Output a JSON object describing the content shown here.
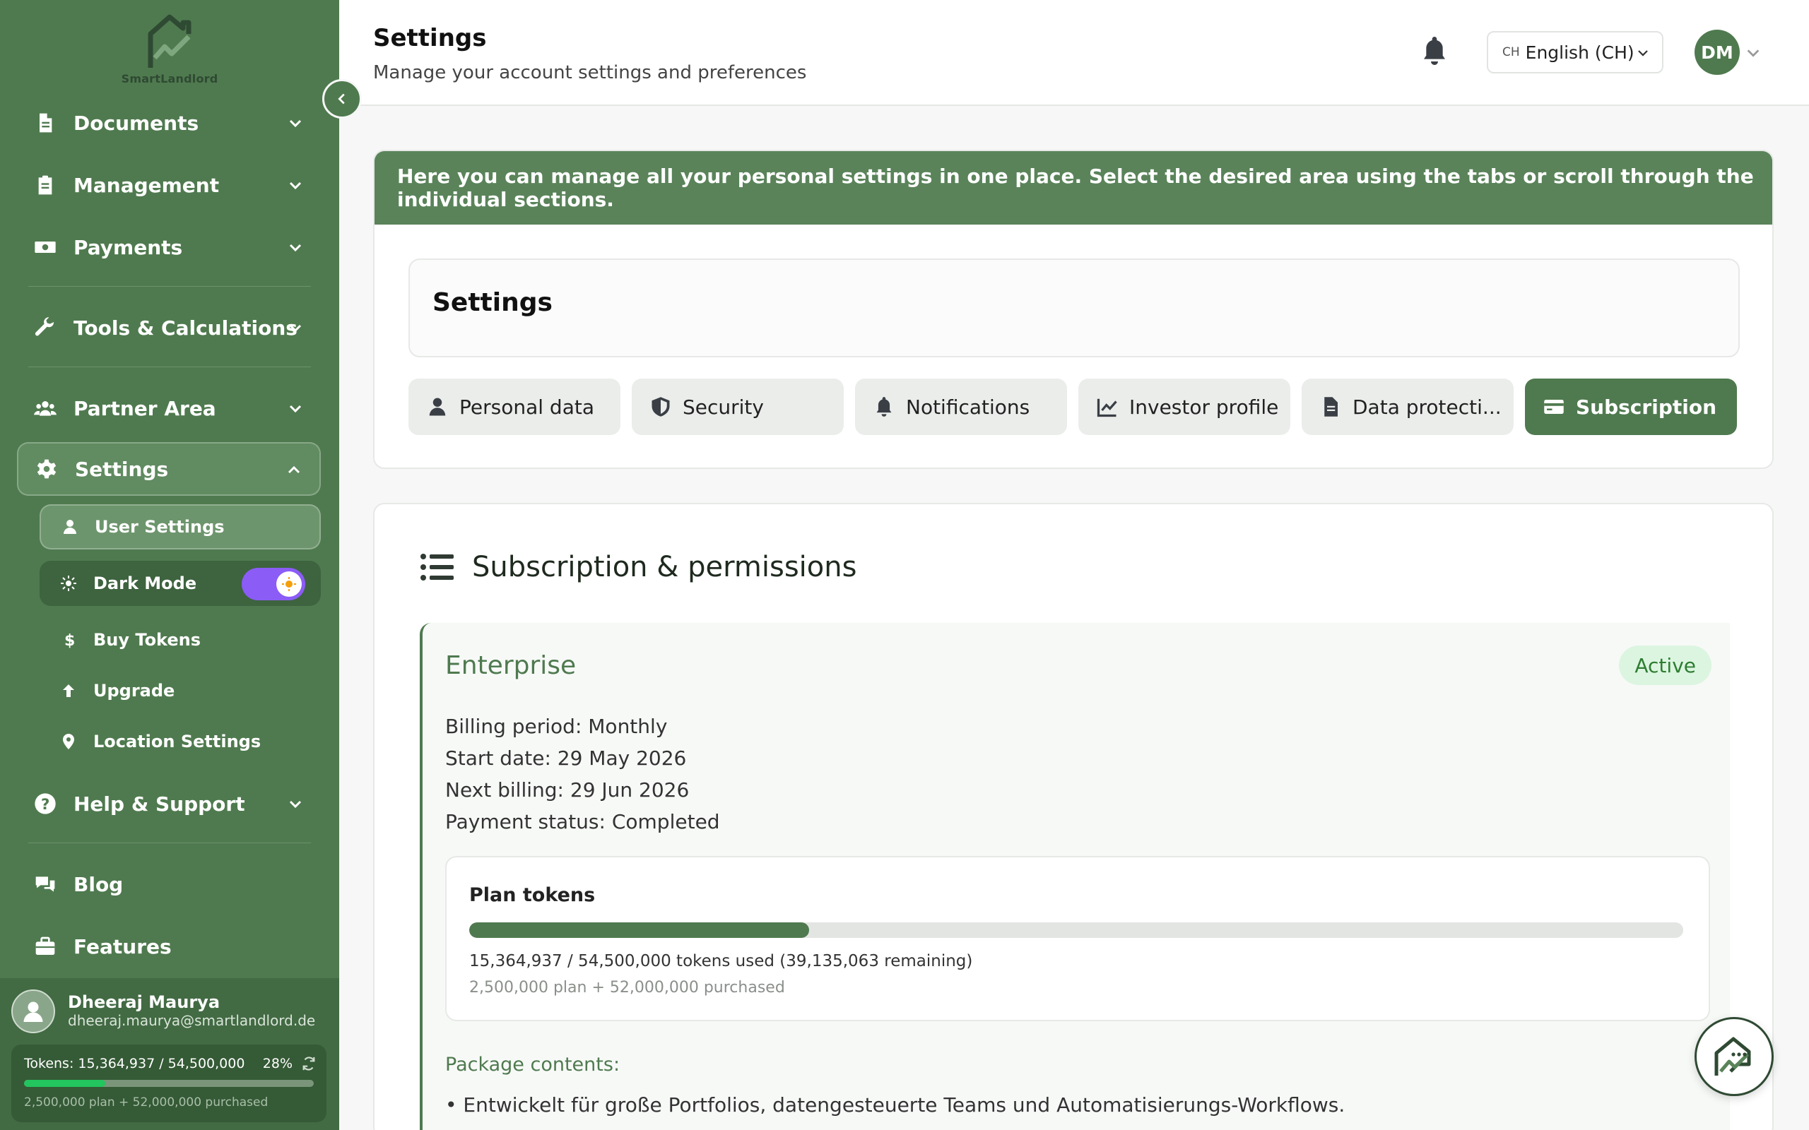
{
  "app": {
    "logo_text": "SmartLandlord"
  },
  "sidebar": {
    "nav": [
      {
        "label": "Documents",
        "icon": "file-icon"
      },
      {
        "label": "Management",
        "icon": "clipboard-icon"
      },
      {
        "label": "Payments",
        "icon": "money-icon"
      },
      {
        "label": "Tools & Calculations",
        "icon": "wrench-icon"
      },
      {
        "label": "Partner Area",
        "icon": "users-icon"
      },
      {
        "label": "Settings",
        "icon": "gear-icon"
      }
    ],
    "settings_sub": [
      {
        "label": "User Settings",
        "icon": "user-icon"
      },
      {
        "label": "Dark Mode",
        "icon": "sun-icon"
      },
      {
        "label": "Buy Tokens",
        "icon": "dollar-icon"
      },
      {
        "label": "Upgrade",
        "icon": "arrow-up-icon"
      },
      {
        "label": "Location Settings",
        "icon": "location-pin-icon"
      }
    ],
    "bottom_nav": [
      {
        "label": "Help & Support",
        "icon": "question-icon"
      },
      {
        "label": "Blog",
        "icon": "comments-icon"
      },
      {
        "label": "Features",
        "icon": "briefcase-icon"
      }
    ],
    "dark_mode_on": true,
    "user": {
      "name": "Dheeraj Maurya",
      "email": "dheeraj.maurya@smartlandlord.de",
      "tokens_label": "Tokens: 15,364,937 / 54,500,000",
      "tokens_pct": "28%",
      "tokens_fraction": 0.28,
      "tokens_breakdown": "2,500,000 plan + 52,000,000 purchased"
    }
  },
  "header": {
    "title": "Settings",
    "subtitle": "Manage your account settings and preferences",
    "language_code": "CH",
    "language_name": "English (CH)",
    "avatar_initials": "DM"
  },
  "main": {
    "banner": "Here you can manage all your personal settings in one place. Select the desired area using the tabs or scroll through the individual sections.",
    "settings_title": "Settings",
    "tabs": [
      {
        "label": "Personal data",
        "icon": "user-icon"
      },
      {
        "label": "Security",
        "icon": "shield-icon"
      },
      {
        "label": "Notifications",
        "icon": "bell-icon"
      },
      {
        "label": "Investor profile",
        "icon": "chart-line-icon"
      },
      {
        "label": "Data protecti...",
        "icon": "document-icon"
      },
      {
        "label": "Subscription",
        "icon": "credit-card-icon"
      }
    ],
    "active_tab": "Subscription",
    "subscription": {
      "heading": "Subscription & permissions",
      "plan_name": "Enterprise",
      "status_badge": "Active",
      "billing_period": "Billing period: Monthly",
      "start_date": "Start date: 29 May 2026",
      "next_billing": "Next billing: 29 Jun 2026",
      "payment_status": "Payment status: Completed",
      "plan_tokens_title": "Plan tokens",
      "plan_tokens_fraction": 0.28,
      "plan_tokens_used": "15,364,937 / 54,500,000 tokens used (39,135,063 remaining)",
      "plan_tokens_breakdown": "2,500,000 plan + 52,000,000 purchased",
      "package_title": "Package contents:",
      "package_items": [
        "• Entwickelt für große Portfolios, datengesteuerte Teams und Automatisierungs-Workflows."
      ]
    }
  },
  "colors": {
    "brand_green": "#4f7a4f",
    "toggle_purple": "#8b5cf6",
    "active_badge_bg": "#dcf5e0"
  }
}
